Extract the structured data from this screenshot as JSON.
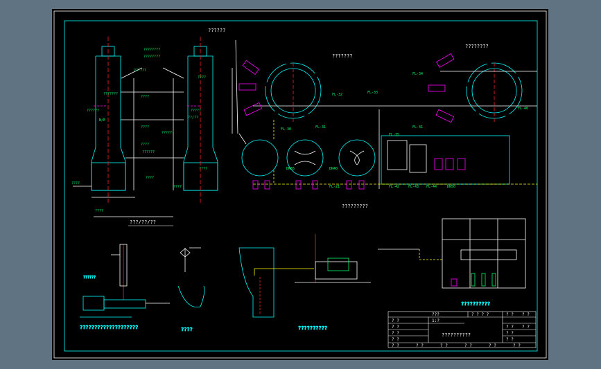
{
  "drawing": {
    "captions": {
      "top_center": "???????",
      "top_left": "??????",
      "top_right": "????????",
      "tower_section": "???/??/??",
      "plan_section": "?????????",
      "pump_section": "????????????????????",
      "valve_detail": "????",
      "piping_section": "??????????",
      "tank_section": "??????????"
    },
    "tower_labels": [
      "????????",
      "????????",
      "??????",
      "???????",
      "????",
      "??????",
      "??/??",
      "N/E",
      "????",
      "????",
      "??????",
      "????",
      "????",
      "????",
      "????",
      "????",
      "??????",
      "????",
      "?????"
    ],
    "plan_labels": [
      "FL-21",
      "FL-30",
      "FL-31",
      "FL-32",
      "FL-33",
      "FL-34",
      "FL-35",
      "FL-40",
      "FL-41",
      "FL-42",
      "FL-43",
      "FL-44",
      "DN50",
      "DN65",
      "DN40"
    ],
    "title_block": {
      "drawing_title": "??????????",
      "header_cells": [
        "???",
        "? ? ? ?",
        "? ?",
        "? ?"
      ],
      "left_rows": [
        "? ?",
        "? ?",
        "? ?",
        "? ?"
      ],
      "right_rows": [
        "? ?",
        "? ?",
        "? ?"
      ],
      "footer_cells": [
        "? ?",
        "? ?",
        "? ?",
        "? ?",
        "? ?",
        "? ?"
      ],
      "scale_label": "1:?",
      "sheet_label": "? ?"
    }
  },
  "colors": {
    "background": "#5f7383",
    "sheet": "#000000",
    "frame": "#00ffff",
    "annotation": "#00ff66",
    "pipe": "#ffff00",
    "centerline": "#ff2222",
    "equipment": "#ff00ff",
    "text": "#ffffff"
  }
}
